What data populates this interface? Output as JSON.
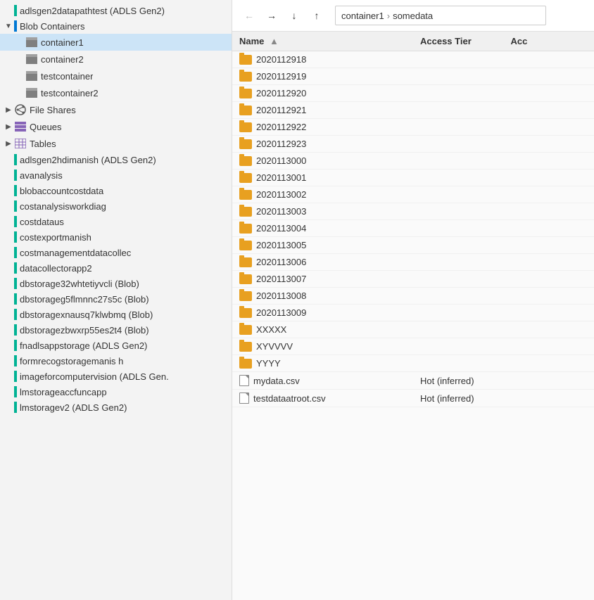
{
  "sidebar": {
    "accounts": [
      {
        "id": "adlsgen2datapathtest",
        "label": "adlsgen2datapathtest (ADLS Gen2)",
        "color": "teal",
        "level": 0
      },
      {
        "id": "blob-containers-header",
        "label": "Blob Containers",
        "color": "blue",
        "level": 0,
        "expanded": true,
        "hasExpand": true
      },
      {
        "id": "container1",
        "label": "container1",
        "level": 1,
        "type": "container",
        "selected": true
      },
      {
        "id": "container2",
        "label": "container2",
        "level": 1,
        "type": "container"
      },
      {
        "id": "testcontainer",
        "label": "testcontainer",
        "level": 1,
        "type": "container"
      },
      {
        "id": "testcontainer2",
        "label": "testcontainer2",
        "level": 1,
        "type": "container"
      },
      {
        "id": "file-shares",
        "label": "File Shares",
        "level": 0,
        "type": "fileshare",
        "hasExpand": true
      },
      {
        "id": "queues",
        "label": "Queues",
        "level": 0,
        "type": "queues",
        "hasExpand": true
      },
      {
        "id": "tables",
        "label": "Tables",
        "level": 0,
        "type": "tables",
        "hasExpand": true
      },
      {
        "id": "adlsgen2hdimanish",
        "label": "adlsgen2hdimanish (ADLS Gen2)",
        "color": "teal",
        "level": 0
      },
      {
        "id": "avanalysis",
        "label": "avanalysis",
        "color": "teal",
        "level": 0
      },
      {
        "id": "blobaccountcostdata",
        "label": "blobaccountcostdata",
        "color": "teal",
        "level": 0
      },
      {
        "id": "costanalysisworkdiag",
        "label": "costanalysisworkdiag",
        "color": "teal",
        "level": 0
      },
      {
        "id": "costdataus",
        "label": "costdataus",
        "color": "teal",
        "level": 0
      },
      {
        "id": "costexportmanish",
        "label": "costexportmanish",
        "color": "teal",
        "level": 0
      },
      {
        "id": "costmanagementdatacollec",
        "label": "costmanagementdatacollec",
        "color": "teal",
        "level": 0
      },
      {
        "id": "datacollectorapp2",
        "label": "datacollectorapp2",
        "color": "teal",
        "level": 0
      },
      {
        "id": "dbstorage32whtetiyvcli",
        "label": "dbstorage32whtetiyvcli (Blob)",
        "color": "teal",
        "level": 0
      },
      {
        "id": "dbstorageg5flmnnc27s5c",
        "label": "dbstorageg5flmnnc27s5c (Blob)",
        "color": "teal",
        "level": 0
      },
      {
        "id": "dbstoragexnausq7klwbmq",
        "label": "dbstoragexnausq7klwbmq (Blob)",
        "color": "teal",
        "level": 0
      },
      {
        "id": "dbstoragezbwxrp55es2t4",
        "label": "dbstoragezbwxrp55es2t4 (Blob)",
        "color": "teal",
        "level": 0
      },
      {
        "id": "fnadlsappstorage",
        "label": "fnadlsappstorage (ADLS Gen2)",
        "color": "teal",
        "level": 0
      },
      {
        "id": "formrecogstorage",
        "label": "formrecogstoragemanis h",
        "color": "teal",
        "level": 0
      },
      {
        "id": "imageforcomputervision",
        "label": "imageforcomputervision (ADLS Gen.",
        "color": "teal",
        "level": 0
      },
      {
        "id": "lmstorageaccfuncapp",
        "label": "lmstorageaccfuncapp",
        "color": "teal",
        "level": 0
      },
      {
        "id": "lmstoragev2",
        "label": "lmstoragev2 (ADLS Gen2)",
        "color": "teal",
        "level": 0
      }
    ]
  },
  "breadcrumb": {
    "parts": [
      "container1",
      "somedata"
    ]
  },
  "toolbar": {
    "back_title": "Back",
    "forward_title": "Forward",
    "down_title": "Down",
    "up_title": "Up"
  },
  "table": {
    "columns": [
      "Name",
      "Access Tier",
      "Acc"
    ],
    "name_sort_indicator": "▲",
    "rows": [
      {
        "id": "r1",
        "name": "2020112918",
        "type": "folder",
        "tier": "",
        "acc": ""
      },
      {
        "id": "r2",
        "name": "2020112919",
        "type": "folder",
        "tier": "",
        "acc": ""
      },
      {
        "id": "r3",
        "name": "2020112920",
        "type": "folder",
        "tier": "",
        "acc": ""
      },
      {
        "id": "r4",
        "name": "2020112921",
        "type": "folder",
        "tier": "",
        "acc": ""
      },
      {
        "id": "r5",
        "name": "2020112922",
        "type": "folder",
        "tier": "",
        "acc": ""
      },
      {
        "id": "r6",
        "name": "2020112923",
        "type": "folder",
        "tier": "",
        "acc": ""
      },
      {
        "id": "r7",
        "name": "2020113000",
        "type": "folder",
        "tier": "",
        "acc": ""
      },
      {
        "id": "r8",
        "name": "2020113001",
        "type": "folder",
        "tier": "",
        "acc": ""
      },
      {
        "id": "r9",
        "name": "2020113002",
        "type": "folder",
        "tier": "",
        "acc": ""
      },
      {
        "id": "r10",
        "name": "2020113003",
        "type": "folder",
        "tier": "",
        "acc": ""
      },
      {
        "id": "r11",
        "name": "2020113004",
        "type": "folder",
        "tier": "",
        "acc": ""
      },
      {
        "id": "r12",
        "name": "2020113005",
        "type": "folder",
        "tier": "",
        "acc": ""
      },
      {
        "id": "r13",
        "name": "2020113006",
        "type": "folder",
        "tier": "",
        "acc": ""
      },
      {
        "id": "r14",
        "name": "2020113007",
        "type": "folder",
        "tier": "",
        "acc": ""
      },
      {
        "id": "r15",
        "name": "2020113008",
        "type": "folder",
        "tier": "",
        "acc": ""
      },
      {
        "id": "r16",
        "name": "2020113009",
        "type": "folder",
        "tier": "",
        "acc": ""
      },
      {
        "id": "r17",
        "name": "XXXXX",
        "type": "folder",
        "tier": "",
        "acc": ""
      },
      {
        "id": "r18",
        "name": "XYVVVV",
        "type": "folder",
        "tier": "",
        "acc": ""
      },
      {
        "id": "r19",
        "name": "YYYY",
        "type": "folder",
        "tier": "",
        "acc": ""
      },
      {
        "id": "r20",
        "name": "mydata.csv",
        "type": "file",
        "tier": "Hot (inferred)",
        "acc": ""
      },
      {
        "id": "r21",
        "name": "testdataatroot.csv",
        "type": "file",
        "tier": "Hot (inferred)",
        "acc": ""
      }
    ]
  }
}
